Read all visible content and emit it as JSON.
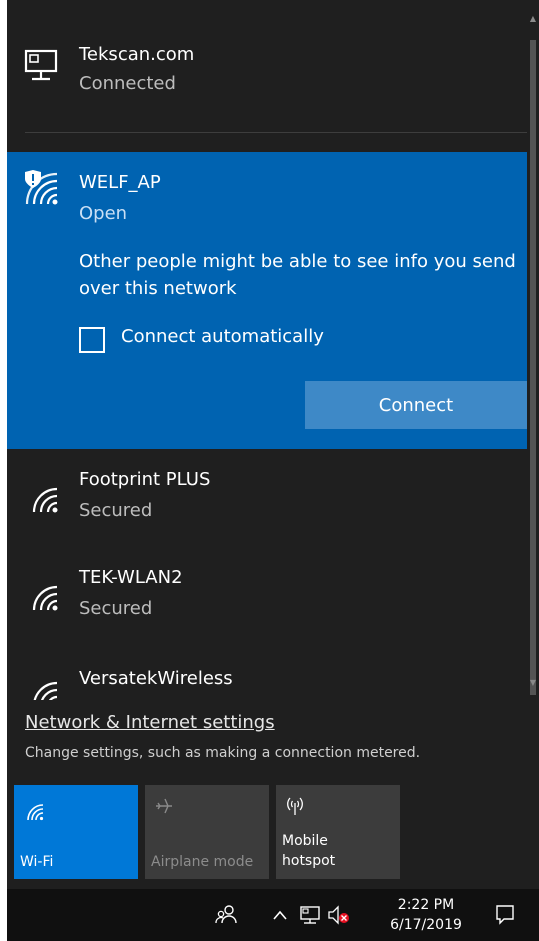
{
  "networks": {
    "ethernet": {
      "name": "Tekscan.com",
      "status": "Connected",
      "icon": "ethernet-icon"
    },
    "selected": {
      "name": "WELF_AP",
      "status": "Open",
      "warning": "Other people might be able to see info you send over this network",
      "auto_connect_label": "Connect automatically",
      "connect_label": "Connect",
      "icon": "wifi-open-shield-icon"
    },
    "others": [
      {
        "name": "Footprint PLUS",
        "status": "Secured",
        "icon": "wifi-icon"
      },
      {
        "name": "TEK-WLAN2",
        "status": "Secured",
        "icon": "wifi-icon"
      },
      {
        "name": "VersatekWireless",
        "status": "",
        "icon": "wifi-icon"
      }
    ]
  },
  "settings": {
    "link_label": "Network & Internet settings",
    "description": "Change settings, such as making a connection metered."
  },
  "quick_actions": {
    "wifi_label": "Wi-Fi",
    "airplane_label": "Airplane mode",
    "hotspot_label_line1": "Mobile",
    "hotspot_label_line2": "hotspot"
  },
  "taskbar": {
    "time": "2:22 PM",
    "date": "6/17/2019"
  },
  "colors": {
    "accent": "#0063b1",
    "flyout_bg": "#1f1f1f",
    "tile_active": "#0078d7",
    "tile_inactive": "#3c3c3c"
  }
}
